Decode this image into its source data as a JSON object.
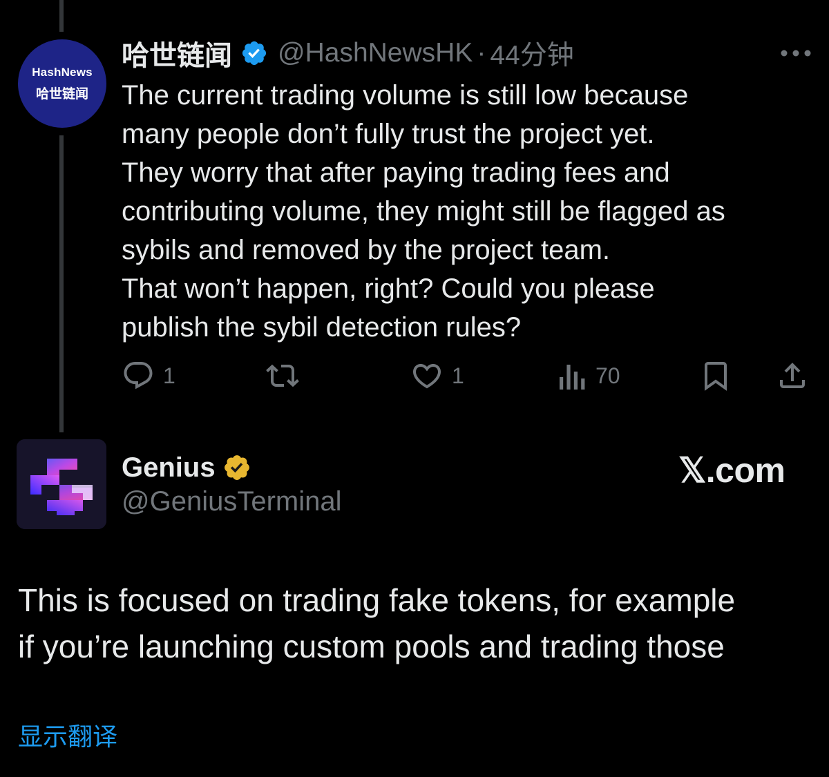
{
  "tweet1": {
    "display_name": "哈世链闻",
    "handle": "@HashNewsHK",
    "separator": "·",
    "time": "44分钟",
    "avatar": {
      "line1": "HashNews",
      "line2": "哈世链闻",
      "background": "#1e2487"
    },
    "body_lines": [
      "The current trading volume is still low because",
      "many people don’t fully trust the project yet.",
      "They worry that after paying trading fees and",
      "contributing volume, they might still be flagged as",
      "sybils and removed by the project team.",
      "That won’t happen, right? Could you please",
      "publish the sybil detection rules?"
    ],
    "actions": {
      "reply_count": "1",
      "repost_count": "",
      "like_count": "1",
      "views_count": "70"
    },
    "verified_color": "#1d9bf0"
  },
  "tweet2": {
    "display_name": "Genius",
    "handle": "@GeniusTerminal",
    "verified_color": "#e8b730",
    "body_lines": [
      "This is focused on trading fake tokens, for example",
      "if you’re launching custom pools and trading those"
    ],
    "translate_label": "显示翻译"
  },
  "watermark": "𝕏.com",
  "colors": {
    "background": "#000000",
    "text_primary": "#e7e9ea",
    "text_secondary": "#71767b",
    "link": "#1d9bf0",
    "thread_line": "#333639"
  },
  "icons": [
    "verified-badge-icon",
    "more-icon",
    "reply-icon",
    "repost-icon",
    "like-icon",
    "views-icon",
    "bookmark-icon",
    "share-icon"
  ]
}
